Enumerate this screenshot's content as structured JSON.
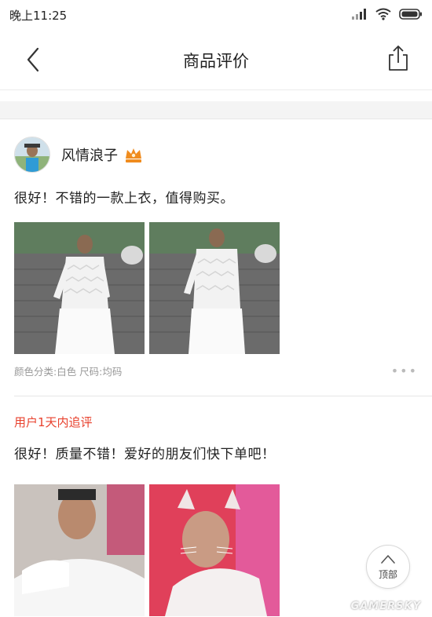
{
  "status_bar": {
    "time": "晚上11:25"
  },
  "nav": {
    "title": "商品评价"
  },
  "review": {
    "username": "风情浪子",
    "text": "很好！不错的一款上衣，值得购买。",
    "spec": "颜色分类:白色  尺码:均码",
    "more": "•••",
    "followup_label": "用户1天内追评",
    "followup_text": "很好！质量不错！爱好的朋友们快下单吧！"
  },
  "back_to_top": {
    "label": "顶部"
  },
  "watermark": "GAMERSKY",
  "colors": {
    "accent": "#e8412d",
    "badge": "#f08c1e"
  },
  "icons": {
    "back": "chevron-left-icon",
    "share": "share-icon",
    "badge": "vip-crown-icon"
  }
}
